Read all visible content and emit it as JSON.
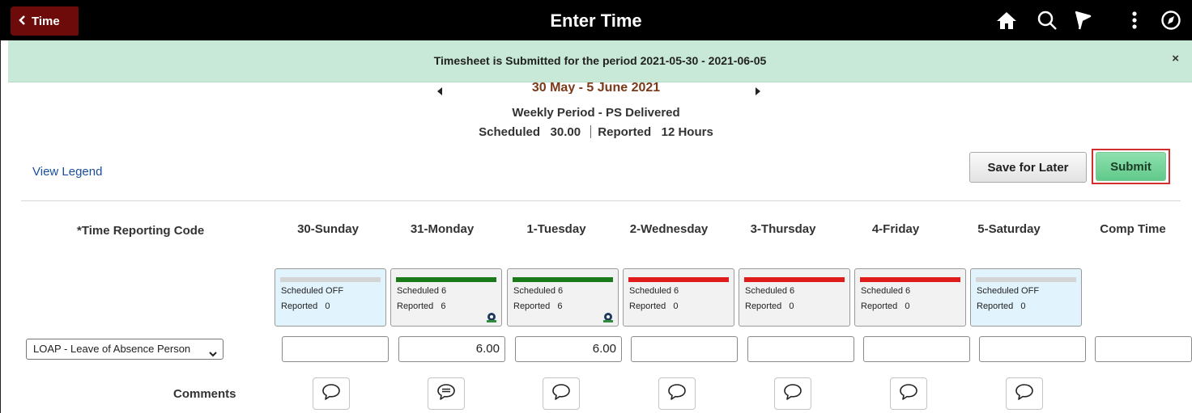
{
  "header": {
    "back_label": "Time",
    "title": "Enter Time",
    "icons": [
      "home-icon",
      "search-icon",
      "flag-icon",
      "more-vertical-icon",
      "navigator-compass-icon"
    ]
  },
  "banner": {
    "message": "Timesheet is Submitted for the period 2021-05-30 - 2021-06-05",
    "close": "×"
  },
  "period": {
    "range": "30 May - 5 June 2021",
    "name": "Weekly Period - PS Delivered",
    "scheduled_label": "Scheduled",
    "scheduled_value": "30.00",
    "reported_label": "Reported",
    "reported_value": "12 Hours"
  },
  "links": {
    "view_legend": "View Legend"
  },
  "actions": {
    "save_for_later": "Save for Later",
    "submit": "Submit"
  },
  "columns": {
    "trc_header": "*Time Reporting Code",
    "days": [
      "30-Sunday",
      "31-Monday",
      "1-Tuesday",
      "2-Wednesday",
      "3-Thursday",
      "4-Friday",
      "5-Saturday"
    ],
    "comp_time": "Comp Time"
  },
  "day_cards": [
    {
      "scheduled": "Scheduled OFF",
      "reported": "Reported   0",
      "status_color": "#d4d4d4",
      "off": true,
      "gear": false
    },
    {
      "scheduled": "Scheduled 6",
      "reported": "Reported   6",
      "status_color": "#1a7a1a",
      "off": false,
      "gear": true
    },
    {
      "scheduled": "Scheduled 6",
      "reported": "Reported   6",
      "status_color": "#1a7a1a",
      "off": false,
      "gear": true
    },
    {
      "scheduled": "Scheduled 6",
      "reported": "Reported   0",
      "status_color": "#e01b1b",
      "off": false,
      "gear": false
    },
    {
      "scheduled": "Scheduled 6",
      "reported": "Reported   0",
      "status_color": "#e01b1b",
      "off": false,
      "gear": false
    },
    {
      "scheduled": "Scheduled 6",
      "reported": "Reported   0",
      "status_color": "#e01b1b",
      "off": false,
      "gear": false
    },
    {
      "scheduled": "Scheduled OFF",
      "reported": "Reported   0",
      "status_color": "#d4d4d4",
      "off": true,
      "gear": false
    }
  ],
  "row": {
    "trc_selected": "LOAP - Leave of Absence Person",
    "hours": [
      "",
      "6.00",
      "6.00",
      "",
      "",
      "",
      "",
      ""
    ]
  },
  "comments": {
    "label": "Comments",
    "icons": [
      "comment-icon",
      "comment-filled-icon",
      "comment-icon",
      "comment-icon",
      "comment-icon",
      "comment-icon",
      "comment-icon"
    ]
  }
}
